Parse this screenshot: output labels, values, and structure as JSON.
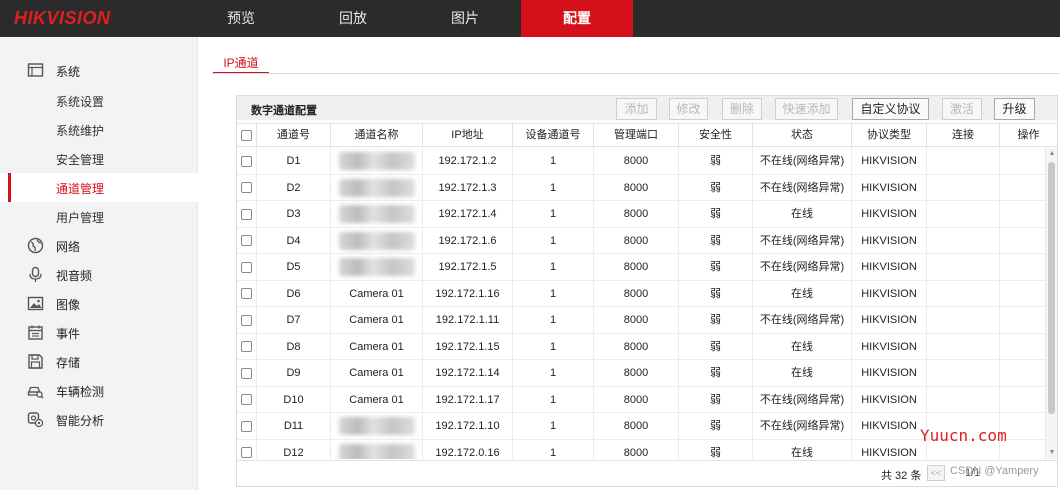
{
  "brand": {
    "logo": "HIKVISION"
  },
  "nav": [
    {
      "label": "预览",
      "active": false
    },
    {
      "label": "回放",
      "active": false
    },
    {
      "label": "图片",
      "active": false
    },
    {
      "label": "配置",
      "active": true
    }
  ],
  "sidebar": {
    "groups": [
      {
        "label": "系统",
        "icon": "monitor-icon"
      },
      {
        "label": "网络",
        "icon": "globe-icon"
      },
      {
        "label": "视音频",
        "icon": "microphone-icon"
      },
      {
        "label": "图像",
        "icon": "image-icon"
      },
      {
        "label": "事件",
        "icon": "calendar-icon"
      },
      {
        "label": "存储",
        "icon": "save-icon"
      },
      {
        "label": "车辆检测",
        "icon": "car-search-icon"
      },
      {
        "label": "智能分析",
        "icon": "smart-analysis-icon"
      }
    ],
    "system_items": [
      {
        "label": "系统设置",
        "active": false
      },
      {
        "label": "系统维护",
        "active": false
      },
      {
        "label": "安全管理",
        "active": false
      },
      {
        "label": "通道管理",
        "active": true
      },
      {
        "label": "用户管理",
        "active": false
      }
    ]
  },
  "tab": {
    "label": "IP通道"
  },
  "panel": {
    "title": "数字通道配置",
    "buttons": {
      "add": "添加",
      "modify": "修改",
      "delete": "删除",
      "quick_add": "快速添加",
      "custom_protocol": "自定义协议",
      "activate": "激活",
      "upgrade": "升级"
    }
  },
  "table": {
    "headers": [
      "通道号",
      "通道名称",
      "IP地址",
      "设备通道号",
      "管理端口",
      "安全性",
      "状态",
      "协议类型",
      "连接",
      "操作"
    ],
    "rows": [
      {
        "ch": "D1",
        "name": "",
        "ip": "192.172.1.2",
        "dev_ch": "1",
        "port": "8000",
        "security": "弱",
        "status": "不在线(网络异常)",
        "protocol": "HIKVISION"
      },
      {
        "ch": "D2",
        "name": "",
        "ip": "192.172.1.3",
        "dev_ch": "1",
        "port": "8000",
        "security": "弱",
        "status": "不在线(网络异常)",
        "protocol": "HIKVISION"
      },
      {
        "ch": "D3",
        "name": "",
        "ip": "192.172.1.4",
        "dev_ch": "1",
        "port": "8000",
        "security": "弱",
        "status": "在线",
        "protocol": "HIKVISION"
      },
      {
        "ch": "D4",
        "name": "",
        "ip": "192.172.1.6",
        "dev_ch": "1",
        "port": "8000",
        "security": "弱",
        "status": "不在线(网络异常)",
        "protocol": "HIKVISION"
      },
      {
        "ch": "D5",
        "name": "",
        "ip": "192.172.1.5",
        "dev_ch": "1",
        "port": "8000",
        "security": "弱",
        "status": "不在线(网络异常)",
        "protocol": "HIKVISION"
      },
      {
        "ch": "D6",
        "name": "Camera 01",
        "ip": "192.172.1.16",
        "dev_ch": "1",
        "port": "8000",
        "security": "弱",
        "status": "在线",
        "protocol": "HIKVISION"
      },
      {
        "ch": "D7",
        "name": "Camera 01",
        "ip": "192.172.1.11",
        "dev_ch": "1",
        "port": "8000",
        "security": "弱",
        "status": "不在线(网络异常)",
        "protocol": "HIKVISION"
      },
      {
        "ch": "D8",
        "name": "Camera 01",
        "ip": "192.172.1.15",
        "dev_ch": "1",
        "port": "8000",
        "security": "弱",
        "status": "在线",
        "protocol": "HIKVISION"
      },
      {
        "ch": "D9",
        "name": "Camera 01",
        "ip": "192.172.1.14",
        "dev_ch": "1",
        "port": "8000",
        "security": "弱",
        "status": "在线",
        "protocol": "HIKVISION"
      },
      {
        "ch": "D10",
        "name": "Camera 01",
        "ip": "192.172.1.17",
        "dev_ch": "1",
        "port": "8000",
        "security": "弱",
        "status": "不在线(网络异常)",
        "protocol": "HIKVISION"
      },
      {
        "ch": "D11",
        "name": "",
        "ip": "192.172.1.10",
        "dev_ch": "1",
        "port": "8000",
        "security": "弱",
        "status": "不在线(网络异常)",
        "protocol": "HIKVISION"
      },
      {
        "ch": "D12",
        "name": "",
        "ip": "192.172.0.16",
        "dev_ch": "1",
        "port": "8000",
        "security": "弱",
        "status": "在线",
        "protocol": "HIKVISION"
      }
    ]
  },
  "footer": {
    "total": "共 32 条",
    "page": "1/1"
  },
  "watermarks": {
    "site": "Yuucn.com",
    "csdn": "CSDN @Yampery"
  },
  "colors": {
    "accent": "#d6101b",
    "topbar": "#2b2b2b",
    "sidebar": "#f3f3f3"
  }
}
